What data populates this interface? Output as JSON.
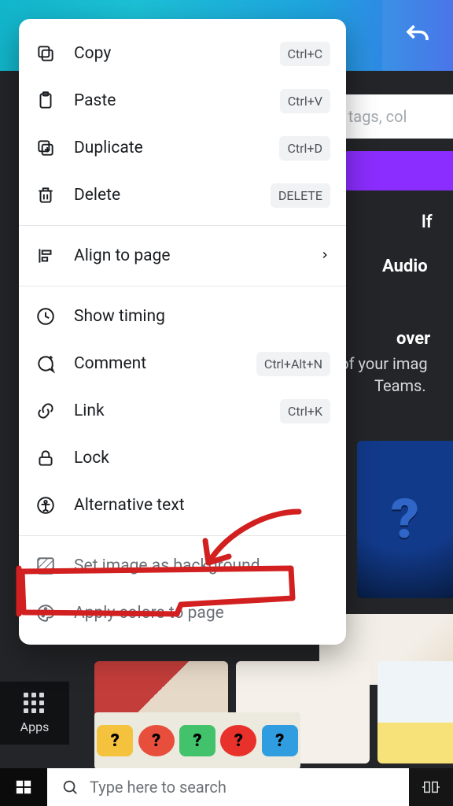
{
  "header": {
    "undo_tooltip": "Undo"
  },
  "search_field": {
    "placeholder": "rd, tags, col"
  },
  "side_text": {
    "lf": "lf",
    "audio": "Audio",
    "over": "over",
    "sub1": "d of your imag",
    "sub2": "Teams."
  },
  "context_menu": {
    "items": [
      {
        "key": "copy",
        "label": "Copy",
        "shortcut": "Ctrl+C"
      },
      {
        "key": "paste",
        "label": "Paste",
        "shortcut": "Ctrl+V"
      },
      {
        "key": "duplicate",
        "label": "Duplicate",
        "shortcut": "Ctrl+D"
      },
      {
        "key": "delete",
        "label": "Delete",
        "shortcut": "DELETE"
      }
    ],
    "align": {
      "label": "Align to page"
    },
    "timing": {
      "label": "Show timing"
    },
    "comment": {
      "label": "Comment",
      "shortcut": "Ctrl+Alt+N"
    },
    "link": {
      "label": "Link",
      "shortcut": "Ctrl+K"
    },
    "lock": {
      "label": "Lock"
    },
    "alt": {
      "label": "Alternative text"
    },
    "set_bg": {
      "label": "Set image as background"
    },
    "apply_colors": {
      "label": "Apply colors to page"
    }
  },
  "sidebar": {
    "apps_label": "Apps"
  },
  "taskbar": {
    "search_placeholder": "Type here to search"
  },
  "annotation": {
    "note": "red hand-drawn highlight around 'Set image as background'"
  }
}
